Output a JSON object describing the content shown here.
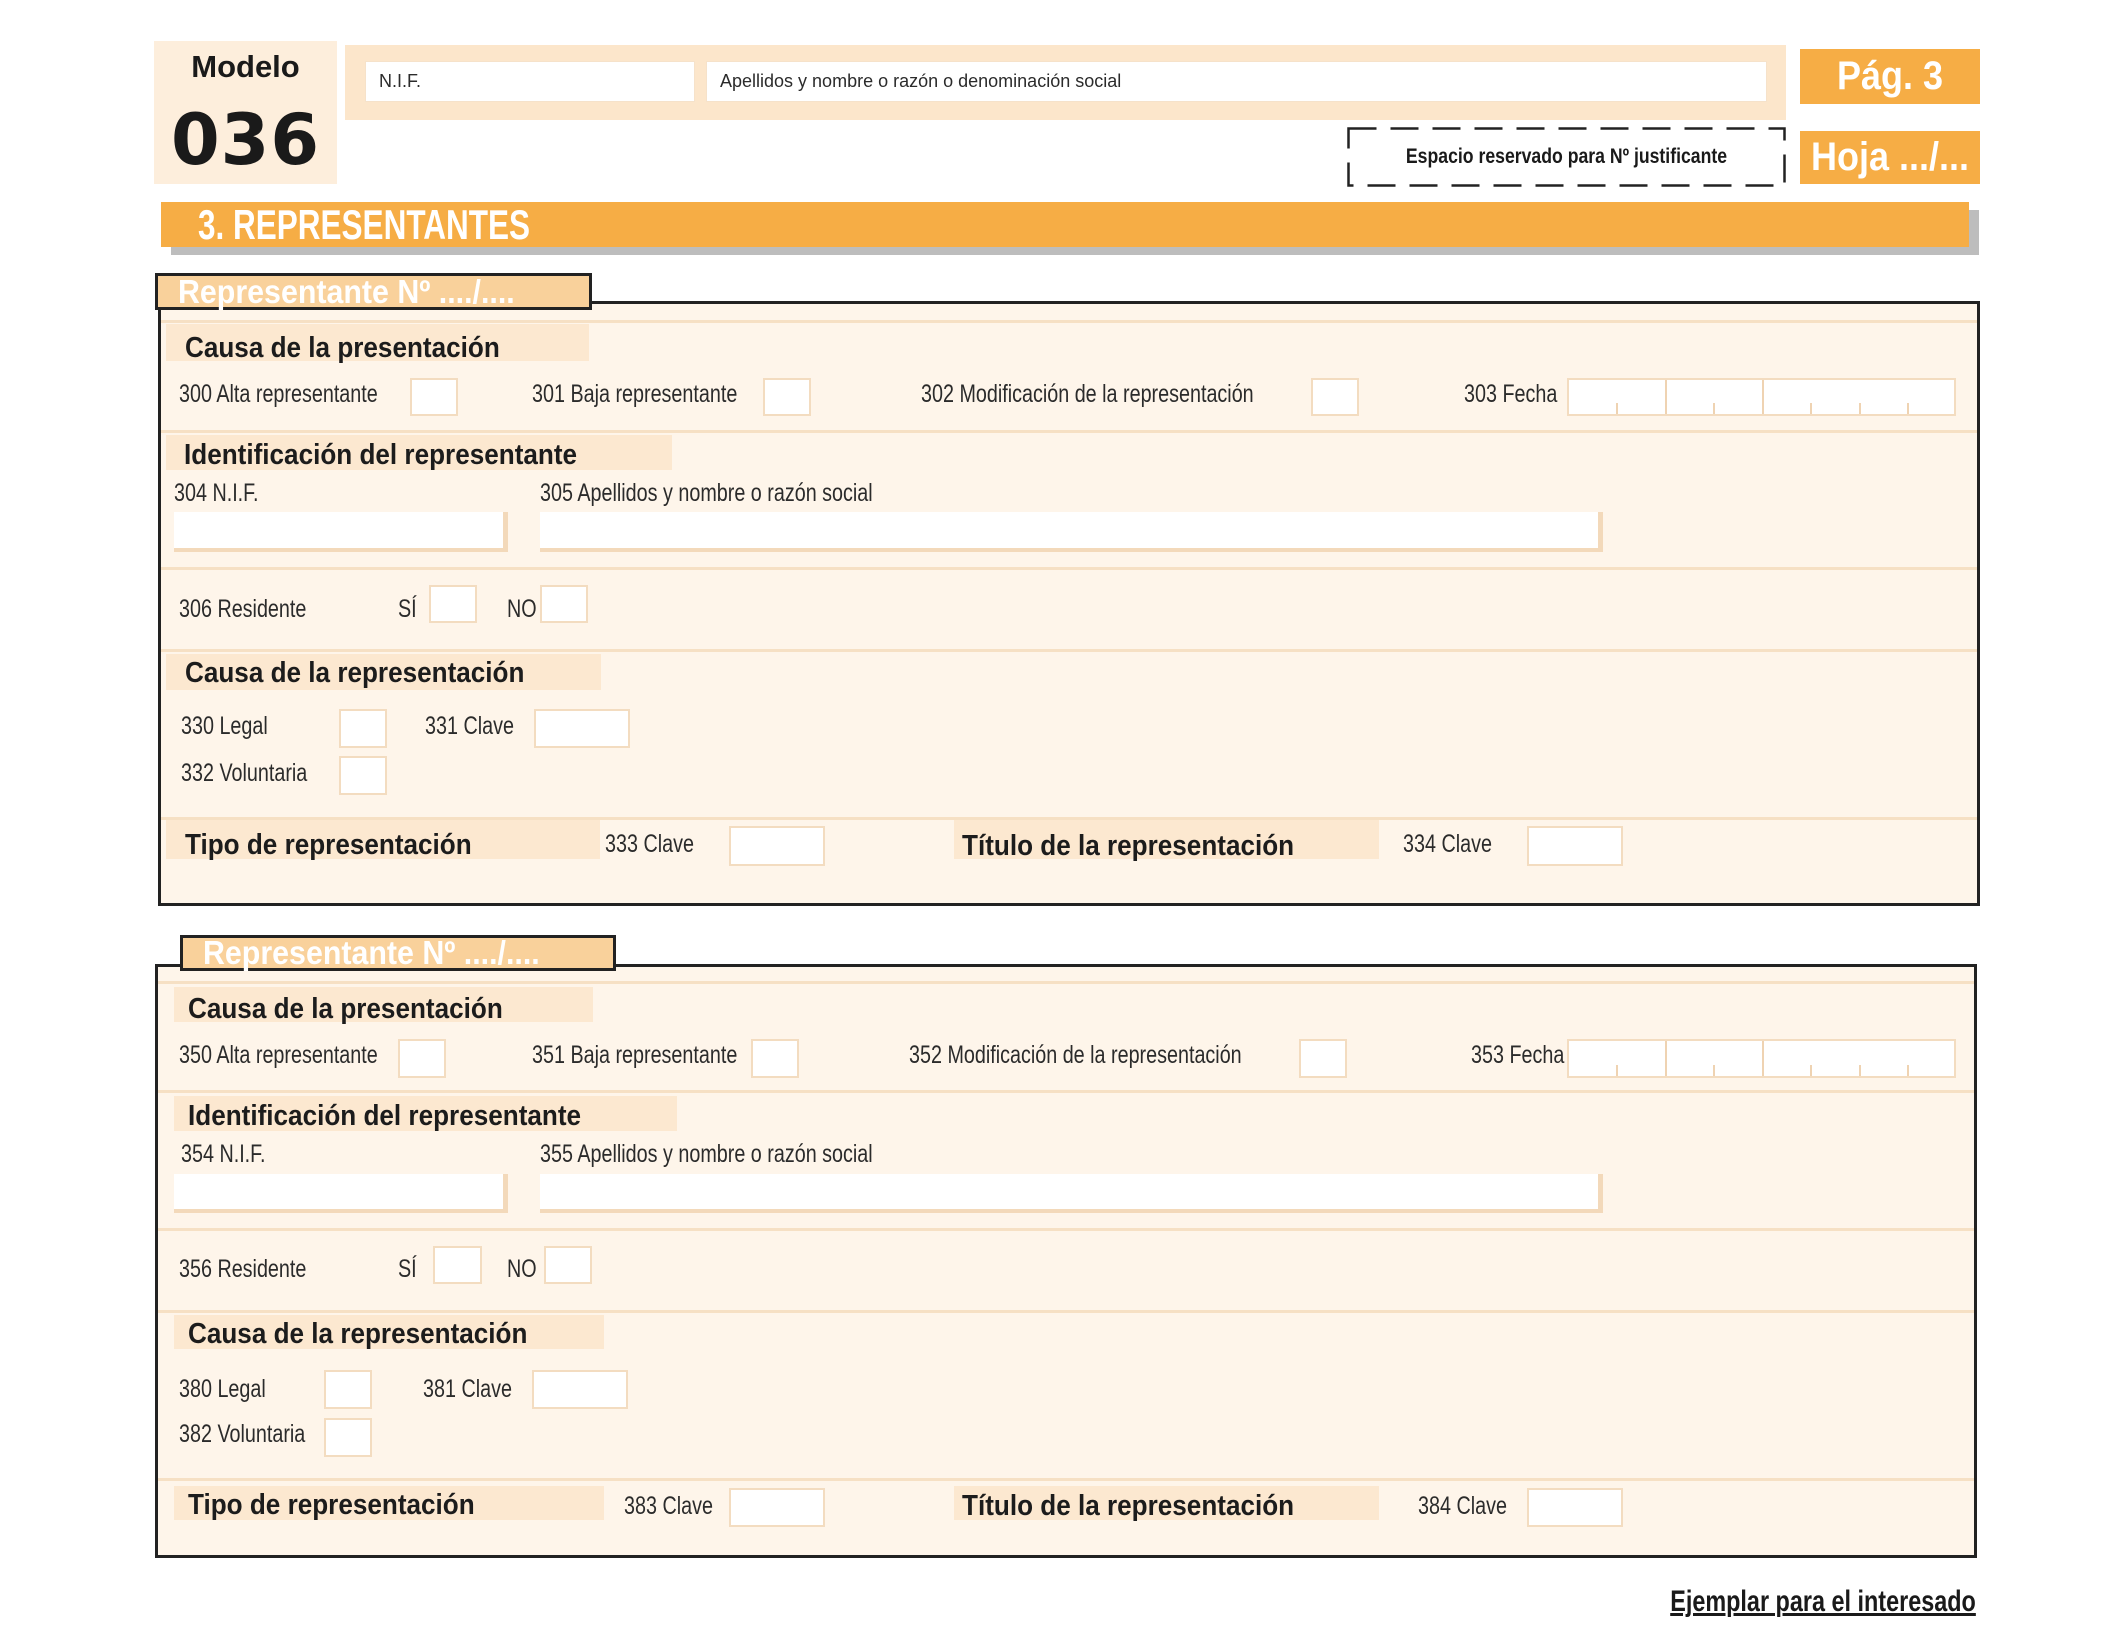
{
  "colors": {
    "orange": "#F6AD45",
    "cream": "#FEF5EA",
    "tab": "#F9D19B",
    "frame": "#222222"
  },
  "modelo": {
    "label": "Modelo",
    "number": "036"
  },
  "header": {
    "nif_label": "N.I.F.",
    "name_label": "Apellidos y nombre o razón o denominación social",
    "justificante_label": "Espacio reservado para Nº justificante",
    "page_label": "Pág. 3",
    "hoja_label": "Hoja .../..."
  },
  "section_title": "3. REPRESENTANTES",
  "representantes": [
    {
      "tab": "Representante Nº ..../....",
      "causa_presentacion": {
        "title": "Causa de la presentación",
        "alta": "300 Alta representante",
        "baja": "301 Baja representante",
        "modificacion": "302 Modificación de la representación",
        "fecha": "303 Fecha"
      },
      "identificacion": {
        "title": "Identificación del representante",
        "nif": "304 N.I.F.",
        "nombre": "305 Apellidos y nombre o razón social"
      },
      "residente": {
        "label": "306 Residente",
        "si": "SÍ",
        "no": "NO"
      },
      "causa_representacion": {
        "title": "Causa de la representación",
        "legal": "330 Legal",
        "clave": "331 Clave",
        "voluntaria": "332 Voluntaria"
      },
      "tipo": {
        "title": "Tipo de representación",
        "clave": "333 Clave"
      },
      "titulo": {
        "title": "Título de la representación",
        "clave": "334 Clave"
      }
    },
    {
      "tab": "Representante Nº ..../....",
      "causa_presentacion": {
        "title": "Causa de la presentación",
        "alta": "350 Alta representante",
        "baja": "351 Baja representante",
        "modificacion": "352 Modificación de la representación",
        "fecha": "353 Fecha"
      },
      "identificacion": {
        "title": "Identificación del representante",
        "nif": "354 N.I.F.",
        "nombre": "355 Apellidos y nombre o razón social"
      },
      "residente": {
        "label": "356 Residente",
        "si": "SÍ",
        "no": "NO"
      },
      "causa_representacion": {
        "title": "Causa de la representación",
        "legal": "380 Legal",
        "clave": "381 Clave",
        "voluntaria": "382 Voluntaria"
      },
      "tipo": {
        "title": "Tipo de representación",
        "clave": "383 Clave"
      },
      "titulo": {
        "title": "Título de la representación",
        "clave": "384 Clave"
      }
    }
  ],
  "footer": "Ejemplar para el interesado"
}
